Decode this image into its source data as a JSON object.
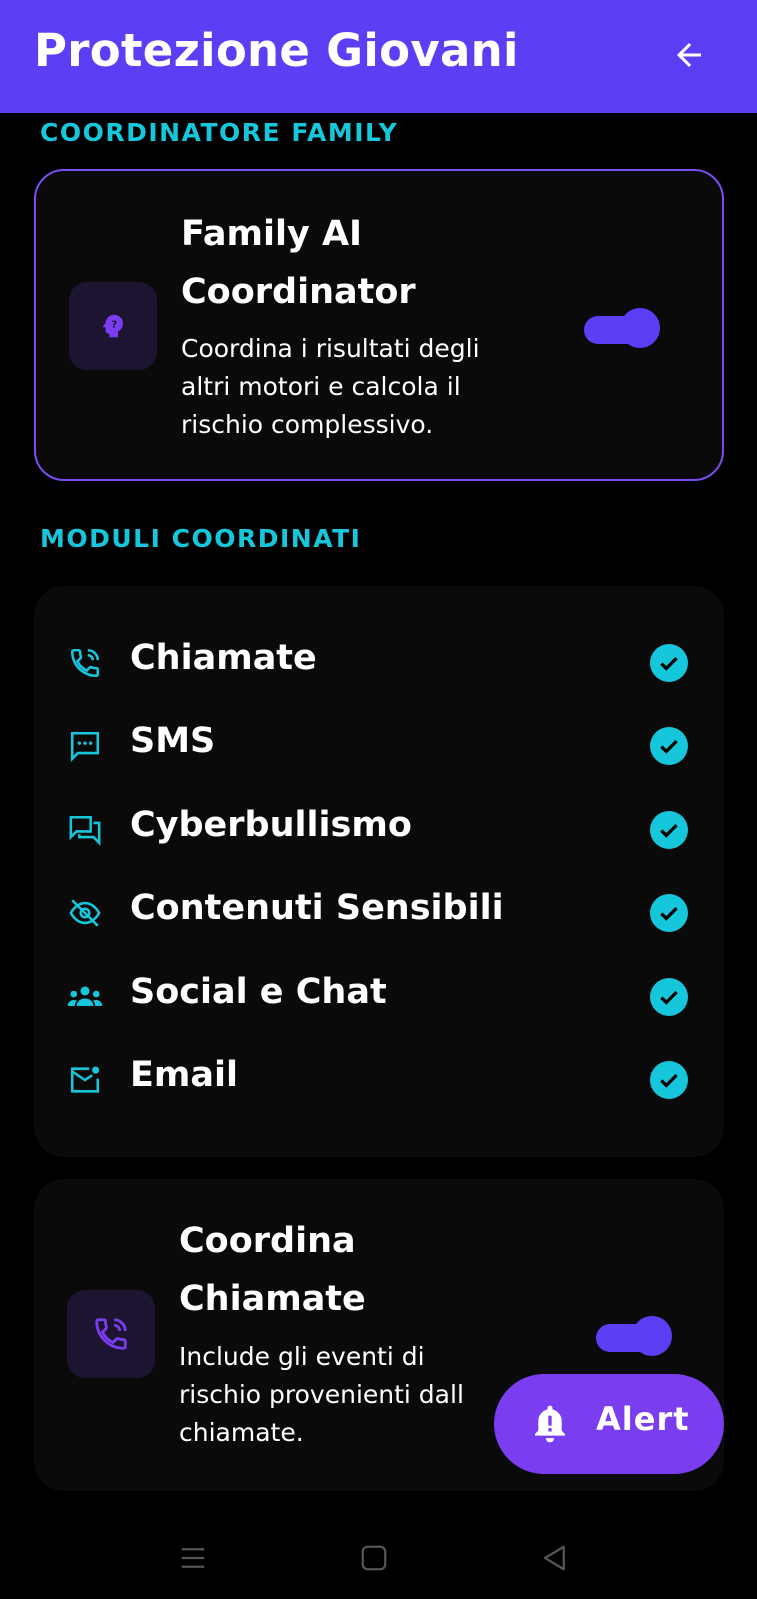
{
  "appbar": {
    "title": "Protezione Giovani",
    "back_icon": "arrow-left-icon"
  },
  "colors": {
    "accent": "#5b3ff5",
    "section_label": "#16c7dc",
    "card_border": "#7a4df0",
    "fab": "#7a3df0"
  },
  "section_family": {
    "label": "COORDINATORE FAMILY"
  },
  "family_card": {
    "title_line1": "Family AI",
    "title_line2": "Coordinator",
    "desc_line1": "Coordina i risultati degli",
    "desc_line2": "altri motori e calcola il",
    "desc_line3": "rischio complessivo.",
    "icon": "head-question-icon",
    "enabled": true
  },
  "section_modules": {
    "label": "MODULI COORDINATI"
  },
  "modules": [
    {
      "label": "Chiamate",
      "icon": "phone-call-icon",
      "active": true
    },
    {
      "label": "SMS",
      "icon": "sms-icon",
      "active": true
    },
    {
      "label": "Cyberbullismo",
      "icon": "forum-icon",
      "active": true
    },
    {
      "label": "Contenuti Sensibili",
      "icon": "eye-off-icon",
      "active": true
    },
    {
      "label": "Social e Chat",
      "icon": "groups-icon",
      "active": true
    },
    {
      "label": "Email",
      "icon": "mail-unread-icon",
      "active": true
    }
  ],
  "calls_card": {
    "title_line1": "Coordina",
    "title_line2": "Chiamate",
    "desc_line1": "Include gli eventi di",
    "desc_line2": "rischio provenienti dall",
    "desc_line3": "chiamate.",
    "icon": "phone-call-icon",
    "enabled": true
  },
  "fab": {
    "label": "Alert",
    "icon": "bell-alert-icon"
  },
  "navbar": {
    "menu_icon": "menu-icon",
    "home_icon": "home-square-icon",
    "back_icon": "back-triangle-icon"
  }
}
